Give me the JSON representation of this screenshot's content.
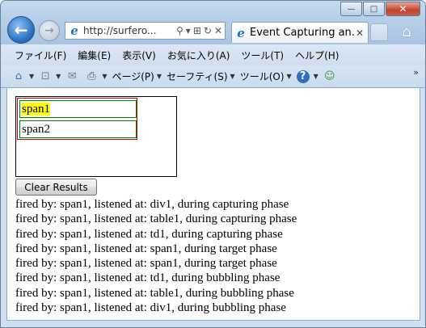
{
  "browser": {
    "address": {
      "url": "http://surfero...",
      "tools": [
        "⚲",
        "▾",
        "⊞",
        "↻",
        "✕"
      ]
    },
    "tab": {
      "title": "Event Capturing an...",
      "close": "✕"
    },
    "caption": {
      "minimize": "—",
      "maximize": "□",
      "close": "✕"
    },
    "menu": [
      "ファイル(F)",
      "編集(E)",
      "表示(V)",
      "お気に入り(A)",
      "ツール(T)",
      "ヘルプ(H)"
    ],
    "command_bar": {
      "page_label": "ページ(P)",
      "safety_label": "セーフティ(S)",
      "tools_label": "ツール(O)"
    },
    "more": "»"
  },
  "page": {
    "span1": "span1",
    "span2": "span2",
    "clear_button": "Clear Results",
    "results": [
      "fired by: span1, listened at: div1, during capturing phase",
      "fired by: span1, listened at: table1, during capturing phase",
      "fired by: span1, listened at: td1, during capturing phase",
      "fired by: span1, listened at: span1, during target phase",
      "fired by: span1, listened at: span1, during target phase",
      "fired by: span1, listened at: td1, during bubbling phase",
      "fired by: span1, listened at: table1, during bubbling phase",
      "fired by: span1, listened at: div1, during bubbling phase"
    ]
  },
  "colors": {
    "span_highlight": "#ffff00",
    "table_border": "#cc0000",
    "span_border": "#008000",
    "div_border": "#000000"
  }
}
